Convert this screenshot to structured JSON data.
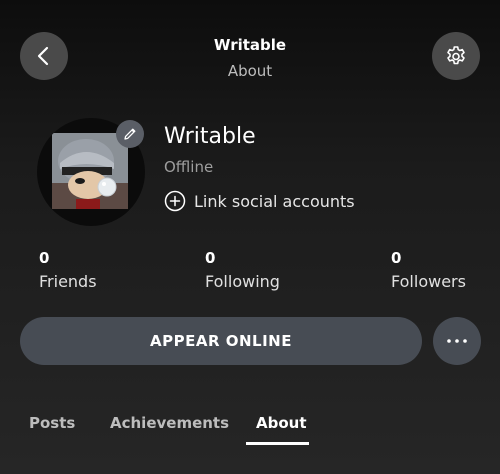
{
  "header": {
    "title": "Writable",
    "subtitle": "About",
    "back_icon": "chevron-left-icon",
    "settings_icon": "gear-icon"
  },
  "profile": {
    "gamertag": "Writable",
    "presence": "Offline",
    "link_social_label": "Link social accounts",
    "edit_icon": "pencil-icon"
  },
  "stats": [
    {
      "count": "0",
      "label": "Friends"
    },
    {
      "count": "0",
      "label": "Following"
    },
    {
      "count": "0",
      "label": "Followers"
    }
  ],
  "actions": {
    "appear_online_label": "APPEAR ONLINE",
    "more_icon": "ellipsis-icon"
  },
  "tabs": [
    {
      "label": "Posts",
      "active": false
    },
    {
      "label": "Achievements",
      "active": false
    },
    {
      "label": "About",
      "active": true
    }
  ],
  "colors": {
    "button_bg": "#474c54",
    "circle_btn_bg": "#4a4a4a",
    "muted_text": "#9e9e9e",
    "active_tab": "#ffffff"
  }
}
